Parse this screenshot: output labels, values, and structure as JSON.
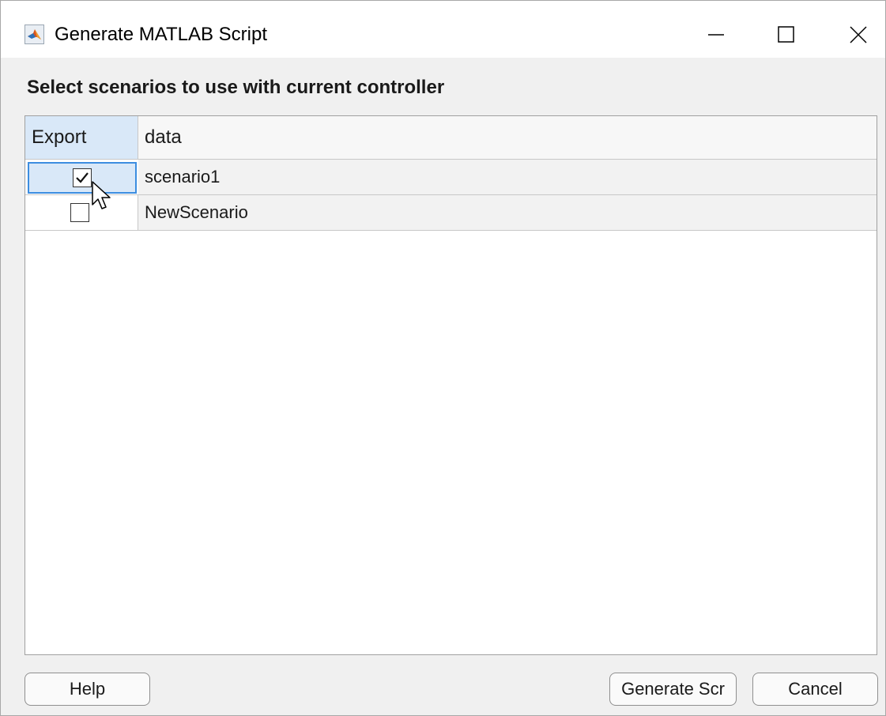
{
  "window": {
    "title": "Generate MATLAB Script",
    "app_icon": "matlab-logo-icon",
    "controls": [
      "minimize-icon",
      "maximize-icon",
      "close-icon"
    ]
  },
  "prompt": "Select scenarios to use with current controller",
  "table": {
    "columns": [
      "Export",
      "data"
    ],
    "rows": [
      {
        "export": true,
        "data": "scenario1"
      },
      {
        "export": false,
        "data": "NewScenario"
      }
    ]
  },
  "buttons": {
    "help": "Help",
    "generate": "Generate Scr",
    "cancel": "Cancel"
  },
  "colors": {
    "header_highlight": "#d9e8f8",
    "focus_border": "#3c8de0"
  }
}
